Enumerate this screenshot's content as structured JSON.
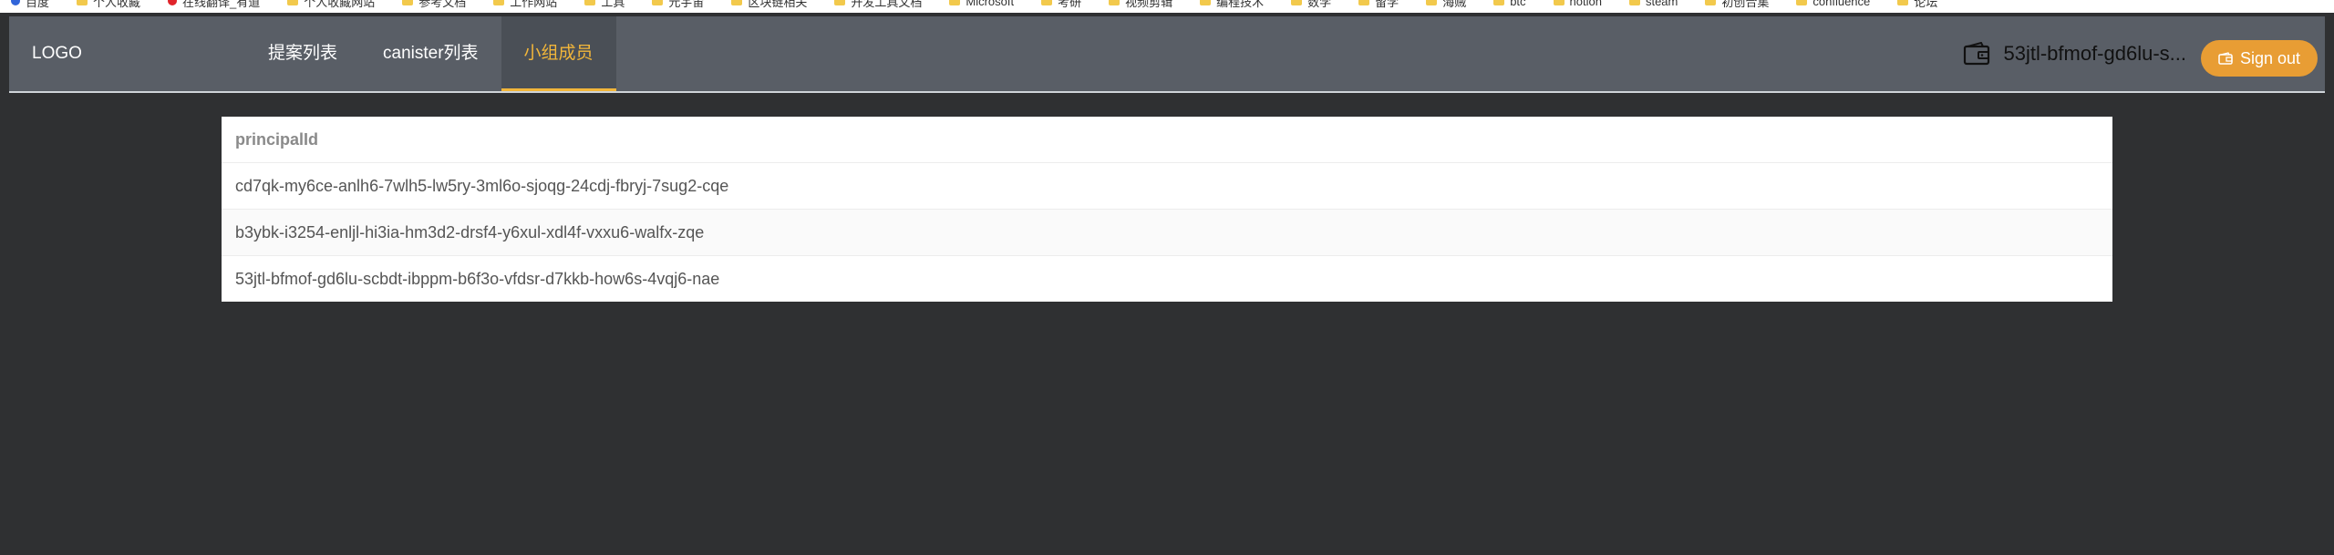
{
  "bookmarks": [
    {
      "label": "百度",
      "icon": "baidu-icon"
    },
    {
      "label": "个人收藏",
      "icon": "folder-icon"
    },
    {
      "label": "在线翻译_有道",
      "icon": "youdao-icon"
    },
    {
      "label": "个人收藏网站",
      "icon": "folder-icon"
    },
    {
      "label": "参考文档",
      "icon": "folder-icon"
    },
    {
      "label": "工作网站",
      "icon": "folder-icon"
    },
    {
      "label": "工具",
      "icon": "folder-icon"
    },
    {
      "label": "元宇宙",
      "icon": "folder-icon"
    },
    {
      "label": "区块链相关",
      "icon": "folder-icon"
    },
    {
      "label": "开发工具文档",
      "icon": "folder-icon"
    },
    {
      "label": "Microsoft",
      "icon": "folder-icon"
    },
    {
      "label": "考研",
      "icon": "folder-icon"
    },
    {
      "label": "视频剪辑",
      "icon": "folder-icon"
    },
    {
      "label": "编程技术",
      "icon": "folder-icon"
    },
    {
      "label": "数学",
      "icon": "folder-icon"
    },
    {
      "label": "留学",
      "icon": "folder-icon"
    },
    {
      "label": "海贼",
      "icon": "folder-icon"
    },
    {
      "label": "btc",
      "icon": "folder-icon"
    },
    {
      "label": "notion",
      "icon": "folder-icon"
    },
    {
      "label": "steam",
      "icon": "folder-icon"
    },
    {
      "label": "初创合集",
      "icon": "folder-icon"
    },
    {
      "label": "confluence",
      "icon": "folder-icon"
    },
    {
      "label": "论坛",
      "icon": "folder-icon"
    }
  ],
  "header": {
    "logo": "LOGO",
    "nav": [
      {
        "label": "提案列表",
        "active": false
      },
      {
        "label": "canister列表",
        "active": false
      },
      {
        "label": "小组成员",
        "active": true
      }
    ],
    "account": "53jtl-bfmof-gd6lu-s...",
    "sign_out": "Sign out"
  },
  "table": {
    "column_header": "principalId",
    "rows": [
      "cd7qk-my6ce-anlh6-7wlh5-lw5ry-3ml6o-sjoqg-24cdj-fbryj-7sug2-cqe",
      "b3ybk-i3254-enljl-hi3ia-hm3d2-drsf4-y6xul-xdl4f-vxxu6-walfx-zqe",
      "53jtl-bfmof-gd6lu-scbdt-ibppm-b6f3o-vfdsr-d7kkb-how6s-4vqj6-nae"
    ]
  },
  "colors": {
    "background": "#2f3032",
    "navbar": "#595e66",
    "accent": "#f2b63a",
    "signout": "#e89d34"
  }
}
